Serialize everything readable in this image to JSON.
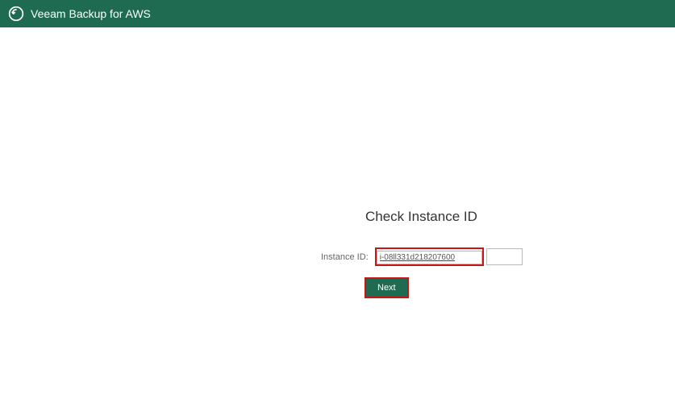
{
  "header": {
    "title": "Veeam Backup for AWS"
  },
  "form": {
    "heading": "Check Instance ID",
    "label": "Instance ID:",
    "input_value": "i-08ll331d218207600",
    "next_label": "Next"
  },
  "colors": {
    "brand": "#1e6b52",
    "highlight": "#c81414"
  }
}
